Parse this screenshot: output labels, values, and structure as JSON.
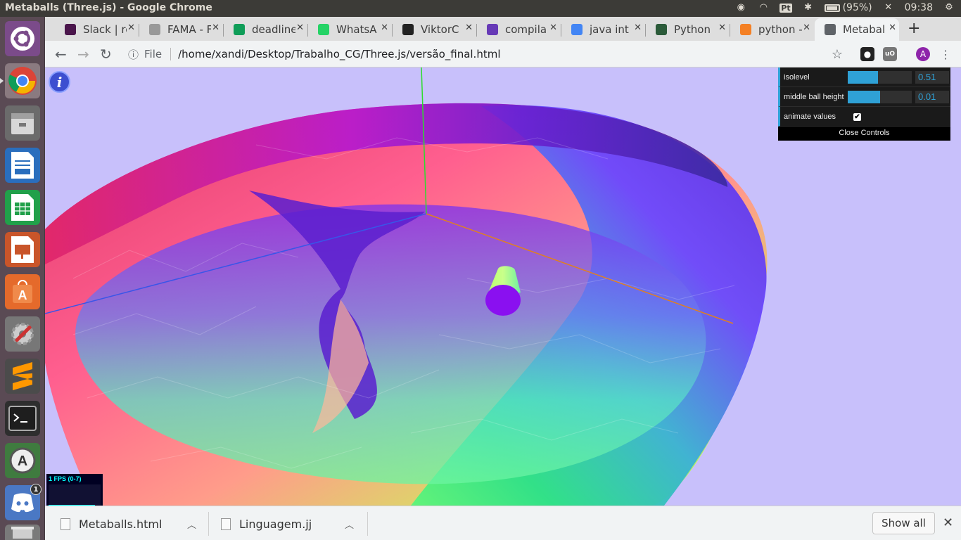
{
  "system": {
    "window_title": "Metaballs (Three.js) - Google Chrome",
    "pt_label": "Pt",
    "battery": "(95%)",
    "time": "09:38"
  },
  "launcher": {
    "discord_badge": "1"
  },
  "tabs": [
    {
      "label": "Slack | re",
      "icon": "slack-icon",
      "color": "#4a154b"
    },
    {
      "label": "FAMA - F",
      "icon": "doc-icon",
      "color": "#999999"
    },
    {
      "label": "deadline",
      "icon": "sheets-icon",
      "color": "#0f9d58"
    },
    {
      "label": "WhatsA",
      "icon": "whatsapp-icon",
      "color": "#25d366"
    },
    {
      "label": "ViktorC",
      "icon": "github-icon",
      "color": "#222222"
    },
    {
      "label": "compila",
      "icon": "forms-icon",
      "color": "#673ab7"
    },
    {
      "label": "java int",
      "icon": "google-icon",
      "color": "#4285f4"
    },
    {
      "label": "Python",
      "icon": "python-icon",
      "color": "#2b5b3a"
    },
    {
      "label": "python -",
      "icon": "stackoverflow-icon",
      "color": "#f48024"
    },
    {
      "label": "Metabal",
      "icon": "page-icon",
      "color": "#5f6368"
    }
  ],
  "address": {
    "scheme_label": "File",
    "url": "/home/xandi/Desktop/Trabalho_CG/Three.js/versão_final.html"
  },
  "profile_initial": "A",
  "gui": {
    "rows": [
      {
        "name": "isolevel",
        "value": "0.51",
        "fill": 0.47
      },
      {
        "name": "middle ball height",
        "value": "0.01",
        "fill": 0.5
      }
    ],
    "animate_label": "animate values",
    "animate_checked": "✔",
    "close_label": "Close Controls"
  },
  "stats": {
    "fps_label": "1 FPS (0-7)"
  },
  "downloads": {
    "items": [
      {
        "name": "Metaballs.html"
      },
      {
        "name": "Linguagem.jj"
      }
    ],
    "show_all": "Show all"
  }
}
